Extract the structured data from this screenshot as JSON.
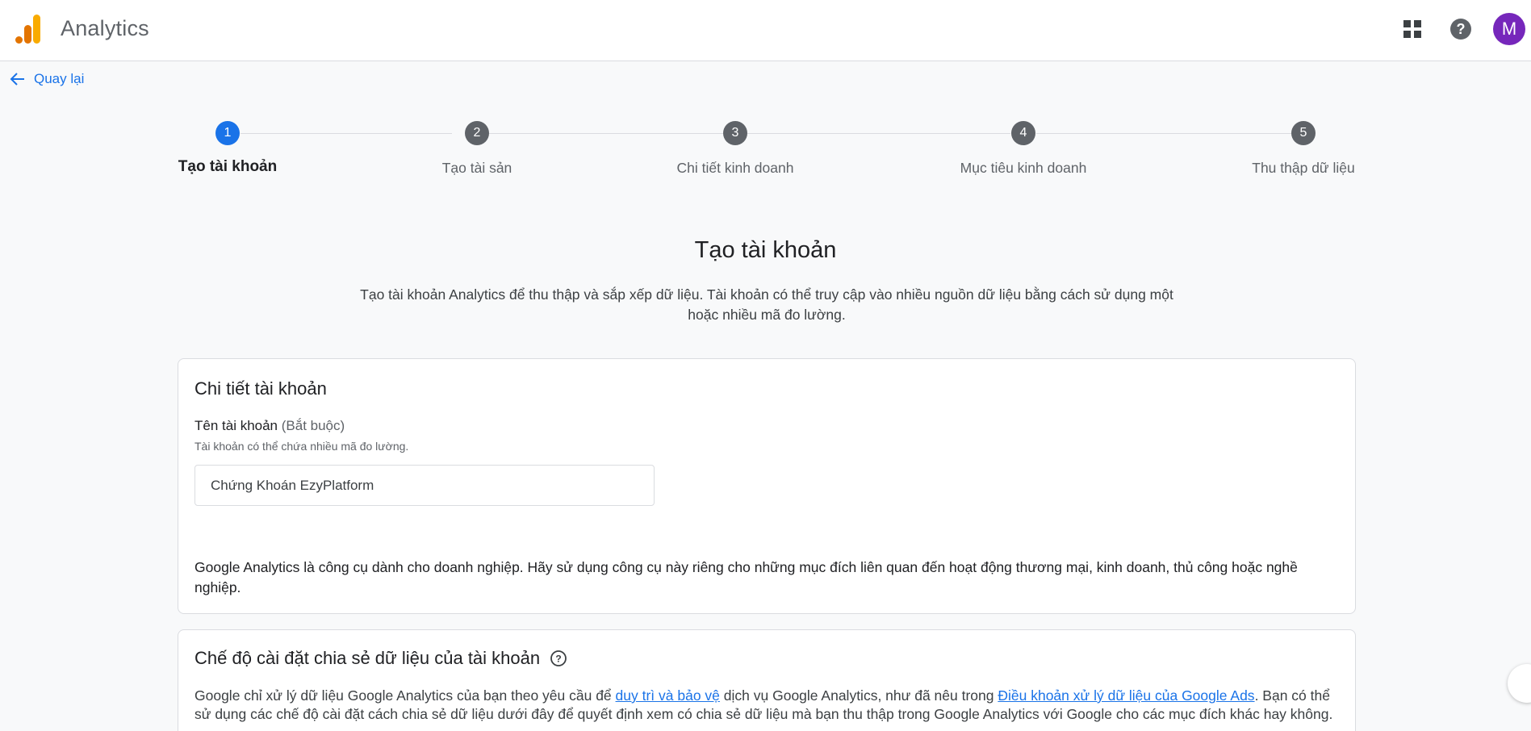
{
  "header": {
    "app_title": "Analytics",
    "logo_icon": "analytics-bars-icon",
    "apps_icon": "apps-grid-icon",
    "help_icon": "help-circle-icon",
    "avatar_initial": "M",
    "avatar_color": "#7627bb"
  },
  "nav": {
    "back_label": "Quay lại"
  },
  "stepper": {
    "steps": [
      {
        "number": "1",
        "label": "Tạo tài khoản",
        "active": true
      },
      {
        "number": "2",
        "label": "Tạo tài sản",
        "active": false
      },
      {
        "number": "3",
        "label": "Chi tiết kinh doanh",
        "active": false
      },
      {
        "number": "4",
        "label": "Mục tiêu kinh doanh",
        "active": false
      },
      {
        "number": "5",
        "label": "Thu thập dữ liệu",
        "active": false
      }
    ]
  },
  "main": {
    "title": "Tạo tài khoản",
    "description": "Tạo tài khoản Analytics để thu thập và sắp xếp dữ liệu. Tài khoản có thể truy cập vào nhiều nguồn dữ liệu bằng cách sử dụng một hoặc nhiều mã đo lường."
  },
  "account_details": {
    "card_title": "Chi tiết tài khoản",
    "field_label": "Tên tài khoản",
    "field_required": "(Bắt buộc)",
    "field_hint": "Tài khoản có thể chứa nhiều mã đo lường.",
    "field_value": "Chứng Khoán EzyPlatform",
    "notice": "Google Analytics là công cụ dành cho doanh nghiệp. Hãy sử dụng công cụ này riêng cho những mục đích liên quan đến hoạt động thương mại, kinh doanh, thủ công hoặc nghề nghiệp."
  },
  "data_sharing": {
    "card_title": "Chế độ cài đặt chia sẻ dữ liệu của tài khoản",
    "text_part1": "Google chỉ xử lý dữ liệu Google Analytics của bạn theo yêu cầu để ",
    "link1": "duy trì và bảo vệ",
    "text_part2": " dịch vụ Google Analytics, như đã nêu trong ",
    "link2": "Điều khoản xử lý dữ liệu của Google Ads",
    "text_part3": ". Bạn có thể sử dụng các chế độ cài đặt cách chia sẻ dữ liệu dưới đây để quyết định xem có chia sẻ dữ liệu mà bạn thu thập trong Google Analytics với Google cho các mục đích khác hay không."
  },
  "colors": {
    "accent": "#1a73e8",
    "inactive_step": "#5f6368",
    "logo_orange": "#f9ab00",
    "logo_dark_orange": "#e37400"
  }
}
